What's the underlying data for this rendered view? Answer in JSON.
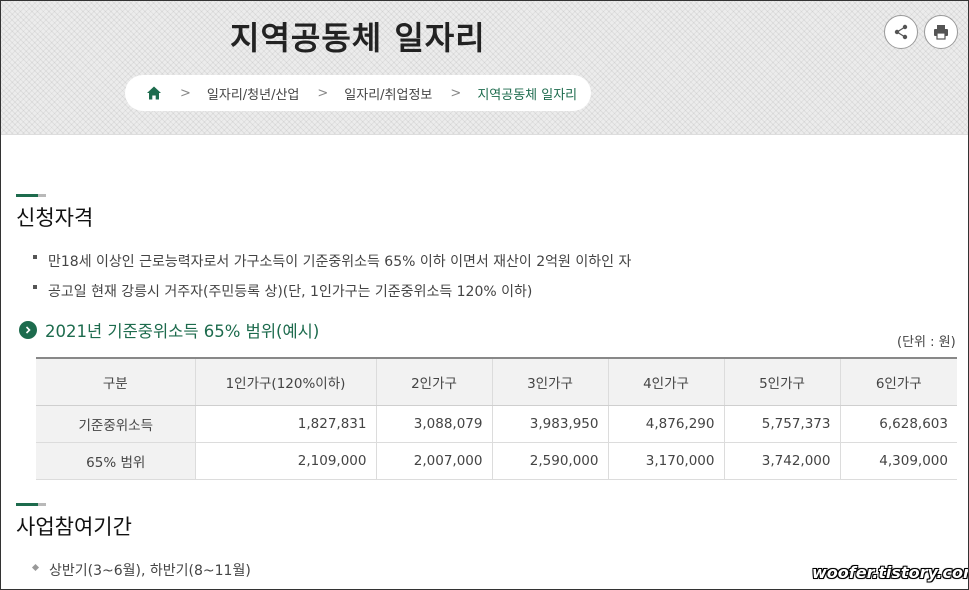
{
  "header": {
    "title": "지역공동체 일자리",
    "share_icon": "share-icon",
    "print_icon": "print-icon"
  },
  "breadcrumb": {
    "home_icon": "home-icon",
    "items": [
      "일자리/청년/산업",
      "일자리/취업정보",
      "지역공동체 일자리"
    ],
    "separator": ">",
    "current_color": "#1d6b4d"
  },
  "section1": {
    "title": "신청자격",
    "bullets": [
      "만18세 이상인 근로능력자로서 가구소득이 기준중위소득 65% 이하 이면서 재산이 2억원 이하인 자",
      "공고일 현재 강릉시 거주자(주민등록 상)(단, 1인가구는 기준중위소득 120% 이하)"
    ]
  },
  "income_table": {
    "heading": "2021년 기준중위소득 65% 범위(예시)",
    "unit": "(단위 : 원)",
    "columns": [
      "구분",
      "1인가구(120%이하)",
      "2인가구",
      "3인가구",
      "4인가구",
      "5인가구",
      "6인가구"
    ],
    "rows": [
      {
        "label": "기준중위소득",
        "values": [
          "1,827,831",
          "3,088,079",
          "3,983,950",
          "4,876,290",
          "5,757,373",
          "6,628,603"
        ]
      },
      {
        "label": "65% 범위",
        "values": [
          "2,109,000",
          "2,007,000",
          "2,590,000",
          "3,170,000",
          "3,742,000",
          "4,309,000"
        ]
      }
    ]
  },
  "section2": {
    "title": "사업참여기간",
    "bullets": [
      "상반기(3~6월), 하반기(8~11월)"
    ]
  },
  "watermark": "woofer.tistory.com",
  "colors": {
    "accent": "#1d6b4d",
    "bar_gray": "#b9b9b9",
    "table_head_bg": "#f2f2f2"
  }
}
